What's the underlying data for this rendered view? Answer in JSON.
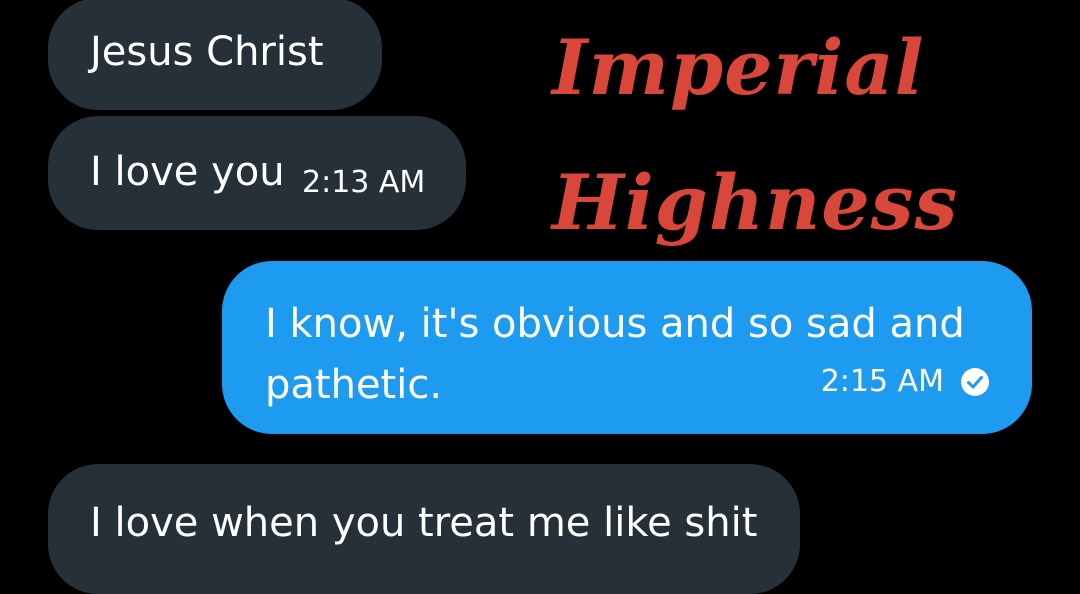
{
  "messages": [
    {
      "direction": "incoming",
      "text": "Jesus Christ"
    },
    {
      "direction": "incoming",
      "text": "I love you",
      "time": "2:13 AM"
    },
    {
      "direction": "outgoing",
      "text": "I know, it's obvious and so sad and pathetic.",
      "time": "2:15 AM",
      "status_icon": "read-check-icon"
    },
    {
      "direction": "incoming",
      "text": "I love when you treat me like shit"
    }
  ],
  "overlay": {
    "line1": "Imperial",
    "line2": "Highness"
  },
  "colors": {
    "background": "#000000",
    "incoming_bubble": "#263038",
    "outgoing_bubble": "#1d9bf0",
    "overlay_text": "#d9463a"
  }
}
